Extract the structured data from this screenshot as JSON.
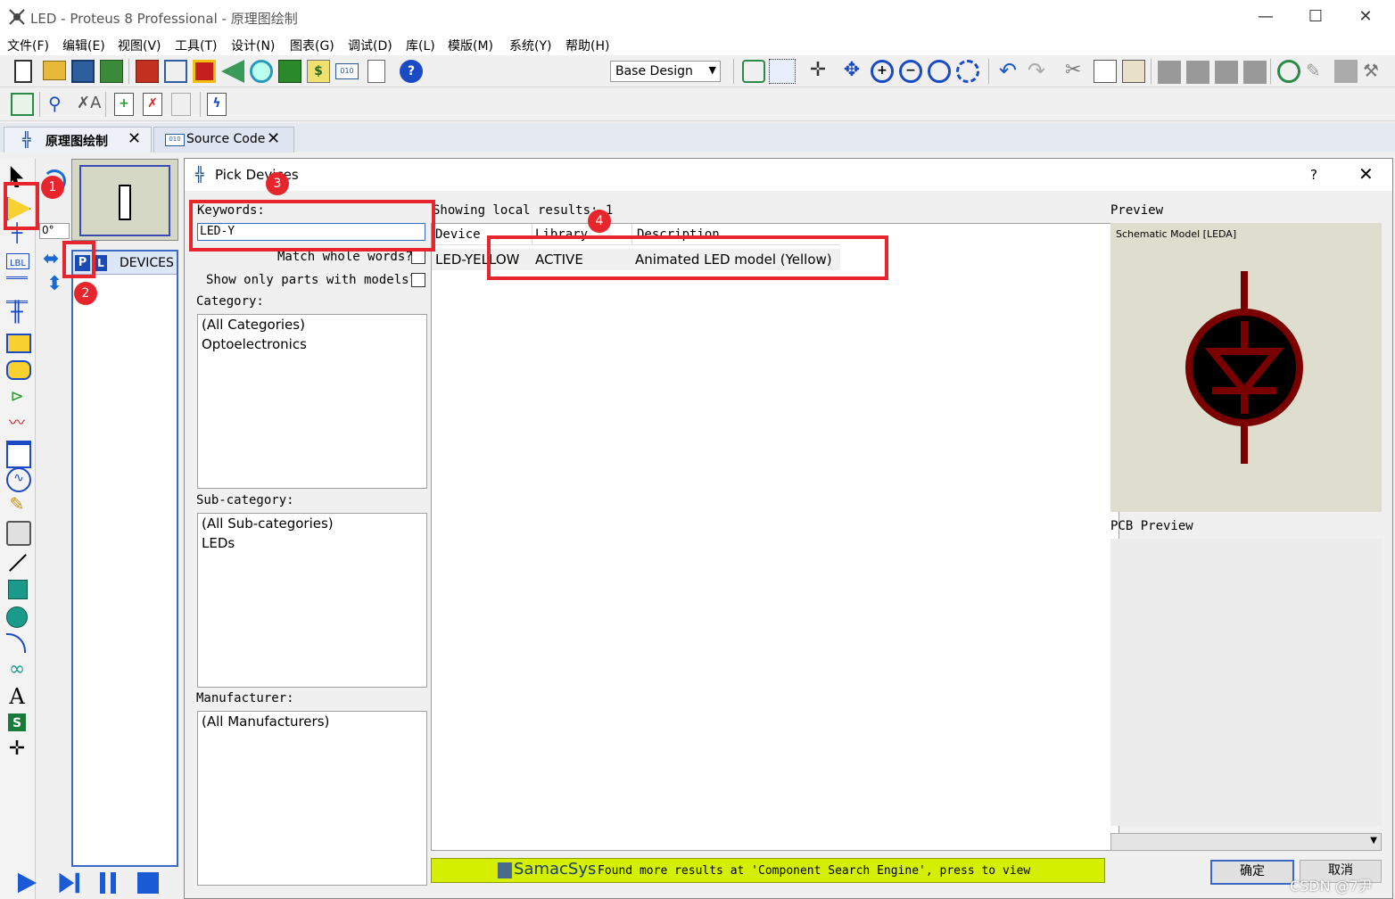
{
  "window": {
    "title": "LED - Proteus 8 Professional - 原理图绘制"
  },
  "menu": [
    "文件(F)",
    "编辑(E)",
    "视图(V)",
    "工具(T)",
    "设计(N)",
    "图表(G)",
    "调试(D)",
    "库(L)",
    "模版(M)",
    "系统(Y)",
    "帮助(H)"
  ],
  "toolbar": {
    "design_select": "Base Design"
  },
  "tabs": [
    {
      "label": "原理图绘制"
    },
    {
      "label": "Source Code"
    }
  ],
  "panel": {
    "angle": "0°",
    "p_button": "P",
    "l_button": "L",
    "devices_label": "DEVICES"
  },
  "dialog": {
    "title": "Pick Devices",
    "help": "?",
    "keywords_label": "Keywords:",
    "keywords_value": "LED-Y",
    "match_whole": "Match whole words?",
    "show_only": "Show only parts with models?",
    "category_label": "Category:",
    "categories": [
      "(All Categories)",
      "Optoelectronics"
    ],
    "subcategory_label": "Sub-category:",
    "subcategories": [
      "(All Sub-categories)",
      "LEDs"
    ],
    "manufacturer_label": "Manufacturer:",
    "manufacturers": [
      "(All Manufacturers)"
    ],
    "results_label": "Showing local results: 1",
    "columns": [
      "Device",
      "Library",
      "Description"
    ],
    "rows": [
      {
        "device": "LED-YELLOW",
        "library": "ACTIVE",
        "description": "Animated LED model (Yellow)"
      }
    ],
    "preview_label": "Preview",
    "schematic_model": "Schematic Model [LEDA]",
    "pcb_preview_label": "PCB Preview",
    "samacsys": "SamacSys",
    "banner_text": "Found more results at 'Component Search Engine', press to view",
    "ok": "确定",
    "cancel": "取消"
  },
  "annotations": [
    "1",
    "2",
    "3",
    "4"
  ],
  "watermark": "CSDN @7尹",
  "colors": {
    "led_body": "#7a0000",
    "banner": "#d4f000",
    "preview_bg": "#dedecf",
    "annotation": "#e6262c"
  }
}
